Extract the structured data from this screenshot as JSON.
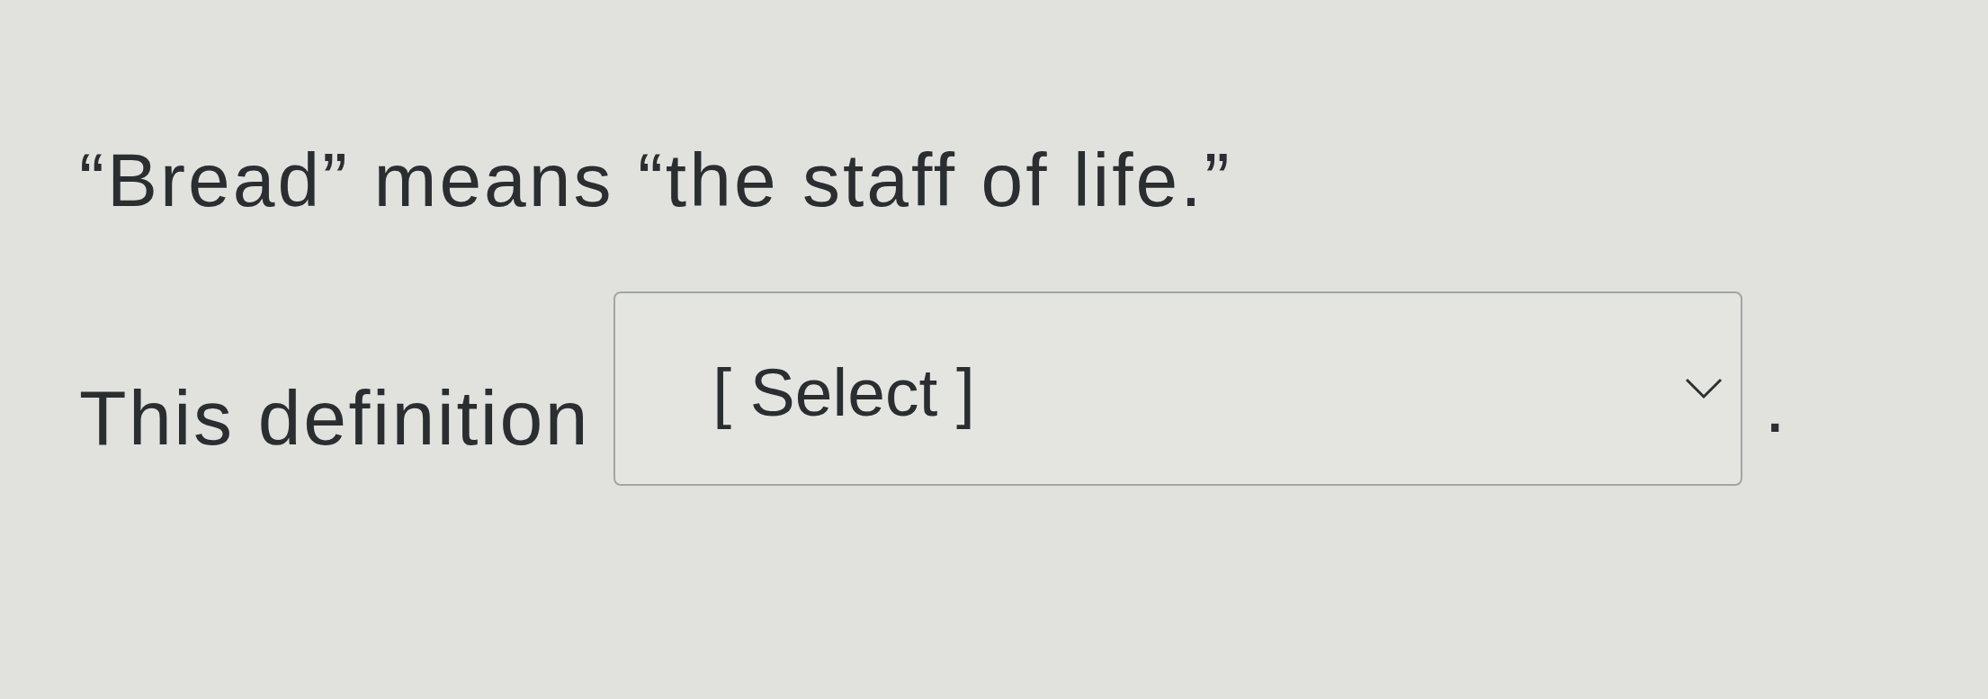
{
  "question": {
    "prompt": "“Bread” means “the staff of life.”",
    "sentence_start": "This definition",
    "dropdown": {
      "placeholder": "[ Select ]"
    },
    "sentence_end": "."
  }
}
